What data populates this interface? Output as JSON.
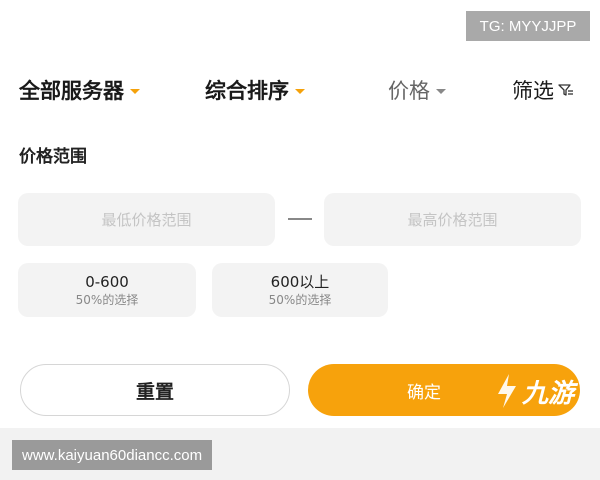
{
  "watermark": {
    "tag": "TG: MYYJJPP",
    "url": "www.kaiyuan60diancc.com"
  },
  "tabs": [
    {
      "label": "全部服务器"
    },
    {
      "label": "综合排序"
    },
    {
      "label": "价格"
    },
    {
      "label": "筛选"
    }
  ],
  "price_section": {
    "title": "价格范围",
    "min_placeholder": "最低价格范围",
    "max_placeholder": "最高价格范围",
    "chips": [
      {
        "value": "0-600",
        "sub": "50%的选择"
      },
      {
        "value": "600以上",
        "sub": "50%的选择"
      }
    ]
  },
  "buttons": {
    "reset": "重置",
    "confirm": "确定"
  },
  "logo": {
    "text": "九游"
  },
  "colors": {
    "accent": "#f7a20c",
    "chip_bg": "#f3f3f3"
  }
}
